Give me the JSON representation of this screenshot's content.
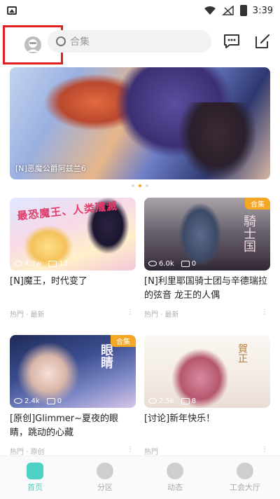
{
  "status_bar": {
    "time": "3:39"
  },
  "header": {
    "search_placeholder": "合集"
  },
  "banner": {
    "caption": "[N]恶魔公爵阿兹兰6",
    "dots": 3,
    "active_dot": 1
  },
  "cards": [
    {
      "tag": "",
      "cover_text": "最恐魔王、人类殲滅",
      "views": "4.3w",
      "comments": "12",
      "title": "[N]魔王，时代变了",
      "meta": "热門 · 最新"
    },
    {
      "tag": "合集",
      "cover_text": "騎士国",
      "views": "6.0k",
      "comments": "0",
      "title": "[N]利里耶国骑士团与辛德瑞拉的弦音 龙王的人偶",
      "meta": "热門 · 最新"
    },
    {
      "tag": "合集",
      "cover_text": "眼睛",
      "views": "2.4k",
      "comments": "0",
      "title": "[原创]Glimmer~夏夜的眼睛，跳动的心藏",
      "meta": "热門 · 原创"
    },
    {
      "tag": "",
      "cover_text": "賀正",
      "views": "2.5k",
      "comments": "8",
      "title": "[讨论]新年快乐！",
      "meta": "热門"
    }
  ],
  "bottom_nav": [
    {
      "label": "首页",
      "active": true
    },
    {
      "label": "分区",
      "active": false
    },
    {
      "label": "动态",
      "active": false
    },
    {
      "label": "工会大厅",
      "active": false
    }
  ],
  "colors": {
    "accent": "#4fd1c5",
    "tag": "#f5a623",
    "highlight_box": "#e0201e"
  }
}
